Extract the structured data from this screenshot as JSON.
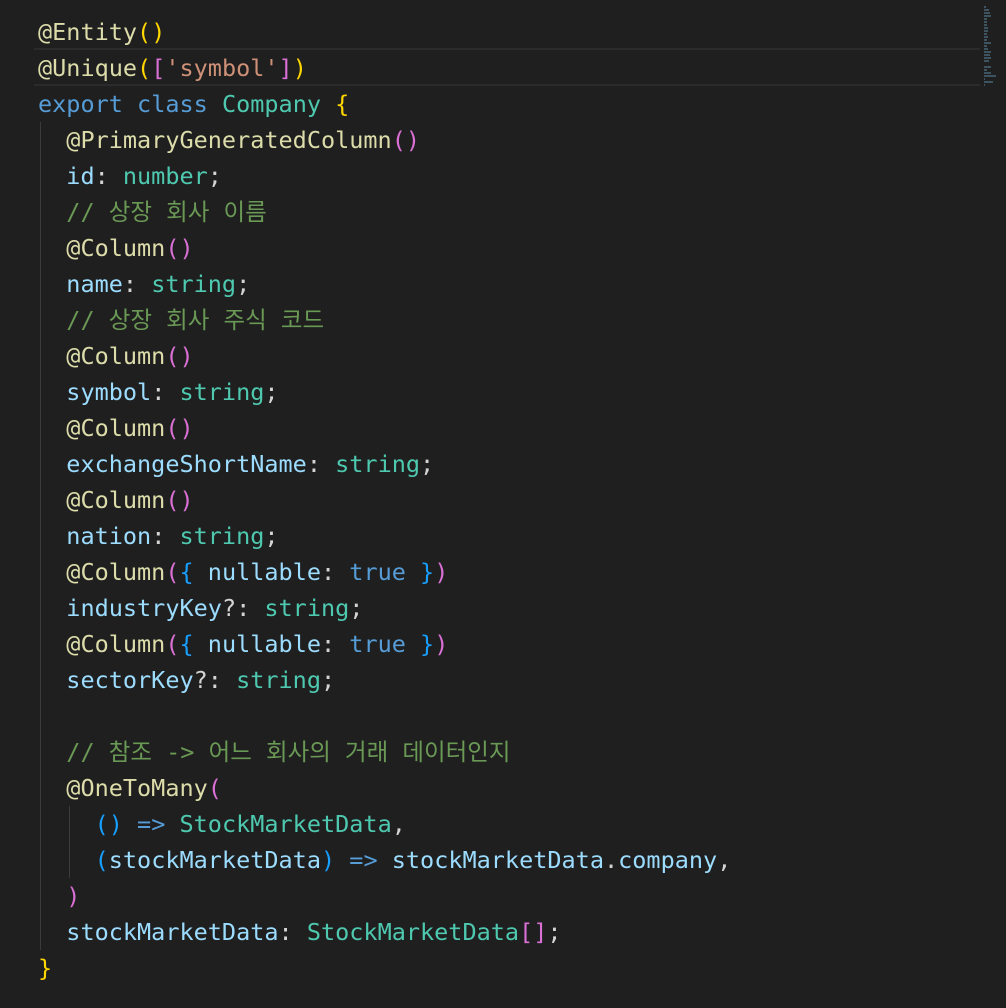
{
  "editor": {
    "lines": [
      [
        {
          "t": "@Entity",
          "c": "dec"
        },
        {
          "t": "()",
          "c": "b1"
        }
      ],
      [
        {
          "t": "@Unique",
          "c": "dec"
        },
        {
          "t": "(",
          "c": "b1"
        },
        {
          "t": "[",
          "c": "b2"
        },
        {
          "t": "'symbol'",
          "c": "str"
        },
        {
          "t": "]",
          "c": "b2"
        },
        {
          "t": ")",
          "c": "b1"
        }
      ],
      [
        {
          "t": "export",
          "c": "kw"
        },
        {
          "t": " ",
          "c": "pun"
        },
        {
          "t": "class",
          "c": "kw"
        },
        {
          "t": " ",
          "c": "pun"
        },
        {
          "t": "Company",
          "c": "cls"
        },
        {
          "t": " ",
          "c": "pun"
        },
        {
          "t": "{",
          "c": "b1"
        }
      ],
      [
        {
          "t": "  ",
          "c": "pun"
        },
        {
          "t": "@PrimaryGeneratedColumn",
          "c": "dec"
        },
        {
          "t": "()",
          "c": "b2"
        }
      ],
      [
        {
          "t": "  ",
          "c": "pun"
        },
        {
          "t": "id",
          "c": "prop"
        },
        {
          "t": ": ",
          "c": "pun"
        },
        {
          "t": "number",
          "c": "cls"
        },
        {
          "t": ";",
          "c": "pun"
        }
      ],
      [
        {
          "t": "  ",
          "c": "pun"
        },
        {
          "t": "// 상장 회사 이름",
          "c": "cmt"
        }
      ],
      [
        {
          "t": "  ",
          "c": "pun"
        },
        {
          "t": "@Column",
          "c": "dec"
        },
        {
          "t": "()",
          "c": "b2"
        }
      ],
      [
        {
          "t": "  ",
          "c": "pun"
        },
        {
          "t": "name",
          "c": "prop"
        },
        {
          "t": ": ",
          "c": "pun"
        },
        {
          "t": "string",
          "c": "cls"
        },
        {
          "t": ";",
          "c": "pun"
        }
      ],
      [
        {
          "t": "  ",
          "c": "pun"
        },
        {
          "t": "// 상장 회사 주식 코드",
          "c": "cmt"
        }
      ],
      [
        {
          "t": "  ",
          "c": "pun"
        },
        {
          "t": "@Column",
          "c": "dec"
        },
        {
          "t": "()",
          "c": "b2"
        }
      ],
      [
        {
          "t": "  ",
          "c": "pun"
        },
        {
          "t": "symbol",
          "c": "prop"
        },
        {
          "t": ": ",
          "c": "pun"
        },
        {
          "t": "string",
          "c": "cls"
        },
        {
          "t": ";",
          "c": "pun"
        }
      ],
      [
        {
          "t": "  ",
          "c": "pun"
        },
        {
          "t": "@Column",
          "c": "dec"
        },
        {
          "t": "()",
          "c": "b2"
        }
      ],
      [
        {
          "t": "  ",
          "c": "pun"
        },
        {
          "t": "exchangeShortName",
          "c": "prop"
        },
        {
          "t": ": ",
          "c": "pun"
        },
        {
          "t": "string",
          "c": "cls"
        },
        {
          "t": ";",
          "c": "pun"
        }
      ],
      [
        {
          "t": "  ",
          "c": "pun"
        },
        {
          "t": "@Column",
          "c": "dec"
        },
        {
          "t": "()",
          "c": "b2"
        }
      ],
      [
        {
          "t": "  ",
          "c": "pun"
        },
        {
          "t": "nation",
          "c": "prop"
        },
        {
          "t": ": ",
          "c": "pun"
        },
        {
          "t": "string",
          "c": "cls"
        },
        {
          "t": ";",
          "c": "pun"
        }
      ],
      [
        {
          "t": "  ",
          "c": "pun"
        },
        {
          "t": "@Column",
          "c": "dec"
        },
        {
          "t": "(",
          "c": "b2"
        },
        {
          "t": "{",
          "c": "b3"
        },
        {
          "t": " nullable",
          "c": "prop"
        },
        {
          "t": ": ",
          "c": "pun"
        },
        {
          "t": "true",
          "c": "bool"
        },
        {
          "t": " ",
          "c": "pun"
        },
        {
          "t": "}",
          "c": "b3"
        },
        {
          "t": ")",
          "c": "b2"
        }
      ],
      [
        {
          "t": "  ",
          "c": "pun"
        },
        {
          "t": "industryKey",
          "c": "prop"
        },
        {
          "t": "?: ",
          "c": "pun"
        },
        {
          "t": "string",
          "c": "cls"
        },
        {
          "t": ";",
          "c": "pun"
        }
      ],
      [
        {
          "t": "  ",
          "c": "pun"
        },
        {
          "t": "@Column",
          "c": "dec"
        },
        {
          "t": "(",
          "c": "b2"
        },
        {
          "t": "{",
          "c": "b3"
        },
        {
          "t": " nullable",
          "c": "prop"
        },
        {
          "t": ": ",
          "c": "pun"
        },
        {
          "t": "true",
          "c": "bool"
        },
        {
          "t": " ",
          "c": "pun"
        },
        {
          "t": "}",
          "c": "b3"
        },
        {
          "t": ")",
          "c": "b2"
        }
      ],
      [
        {
          "t": "  ",
          "c": "pun"
        },
        {
          "t": "sectorKey",
          "c": "prop"
        },
        {
          "t": "?: ",
          "c": "pun"
        },
        {
          "t": "string",
          "c": "cls"
        },
        {
          "t": ";",
          "c": "pun"
        }
      ],
      [],
      [
        {
          "t": "  ",
          "c": "pun"
        },
        {
          "t": "// 참조 -> 어느 회사의 거래 데이터인지",
          "c": "cmt"
        }
      ],
      [
        {
          "t": "  ",
          "c": "pun"
        },
        {
          "t": "@OneToMany",
          "c": "dec"
        },
        {
          "t": "(",
          "c": "b2"
        }
      ],
      [
        {
          "t": "    ",
          "c": "pun"
        },
        {
          "t": "()",
          "c": "b3"
        },
        {
          "t": " ",
          "c": "pun"
        },
        {
          "t": "=>",
          "c": "kw"
        },
        {
          "t": " ",
          "c": "pun"
        },
        {
          "t": "StockMarketData",
          "c": "cls"
        },
        {
          "t": ",",
          "c": "pun"
        }
      ],
      [
        {
          "t": "    ",
          "c": "pun"
        },
        {
          "t": "(",
          "c": "b3"
        },
        {
          "t": "stockMarketData",
          "c": "prop"
        },
        {
          "t": ")",
          "c": "b3"
        },
        {
          "t": " ",
          "c": "pun"
        },
        {
          "t": "=>",
          "c": "kw"
        },
        {
          "t": " ",
          "c": "pun"
        },
        {
          "t": "stockMarketData",
          "c": "prop"
        },
        {
          "t": ".",
          "c": "pun"
        },
        {
          "t": "company",
          "c": "prop"
        },
        {
          "t": ",",
          "c": "pun"
        }
      ],
      [
        {
          "t": "  ",
          "c": "pun"
        },
        {
          "t": ")",
          "c": "b2"
        }
      ],
      [
        {
          "t": "  ",
          "c": "pun"
        },
        {
          "t": "stockMarketData",
          "c": "prop"
        },
        {
          "t": ": ",
          "c": "pun"
        },
        {
          "t": "StockMarketData",
          "c": "cls"
        },
        {
          "t": "[]",
          "c": "b2"
        },
        {
          "t": ";",
          "c": "pun"
        }
      ],
      [
        {
          "t": "}",
          "c": "b1"
        }
      ]
    ],
    "highlighted_lines": [
      0,
      1
    ]
  }
}
